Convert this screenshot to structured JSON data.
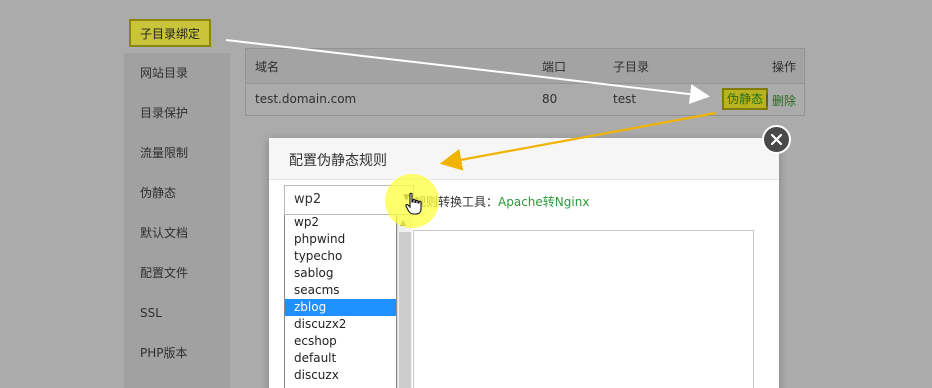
{
  "menu": {
    "active_label": "子目录绑定",
    "items": [
      "网站目录",
      "目录保护",
      "流量限制",
      "伪静态",
      "默认文档",
      "配置文件",
      "SSL",
      "PHP版本"
    ]
  },
  "table": {
    "headers": {
      "domain": "域名",
      "port": "端口",
      "subdir": "子目录",
      "ops": "操作"
    },
    "row": {
      "domain": "test.domain.com",
      "port": "80",
      "subdir": "test",
      "rewrite_button": "伪静态",
      "separator": "|",
      "delete_link": "删除"
    }
  },
  "modal": {
    "title": "配置伪静态规则",
    "select_value": "wp2",
    "tool_label": "规则转换工具：",
    "tool_link": "Apache转Nginx",
    "dropdown_options": [
      "wp2",
      "phpwind",
      "typecho",
      "sablog",
      "seacms",
      "zblog",
      "discuzx2",
      "ecshop",
      "default",
      "discuzx"
    ],
    "highlighted_option": "zblog"
  },
  "colors": {
    "annotation_white_arrow": "#ffffff",
    "annotation_orange_arrow": "#f0b400",
    "selected_option_bg": "#1e90ff",
    "link_green": "#2b9a3a"
  },
  "icons": {
    "close": "close-x-icon",
    "cursor": "hand-pointer-icon",
    "select_arrow": "triangle-down-icon"
  }
}
